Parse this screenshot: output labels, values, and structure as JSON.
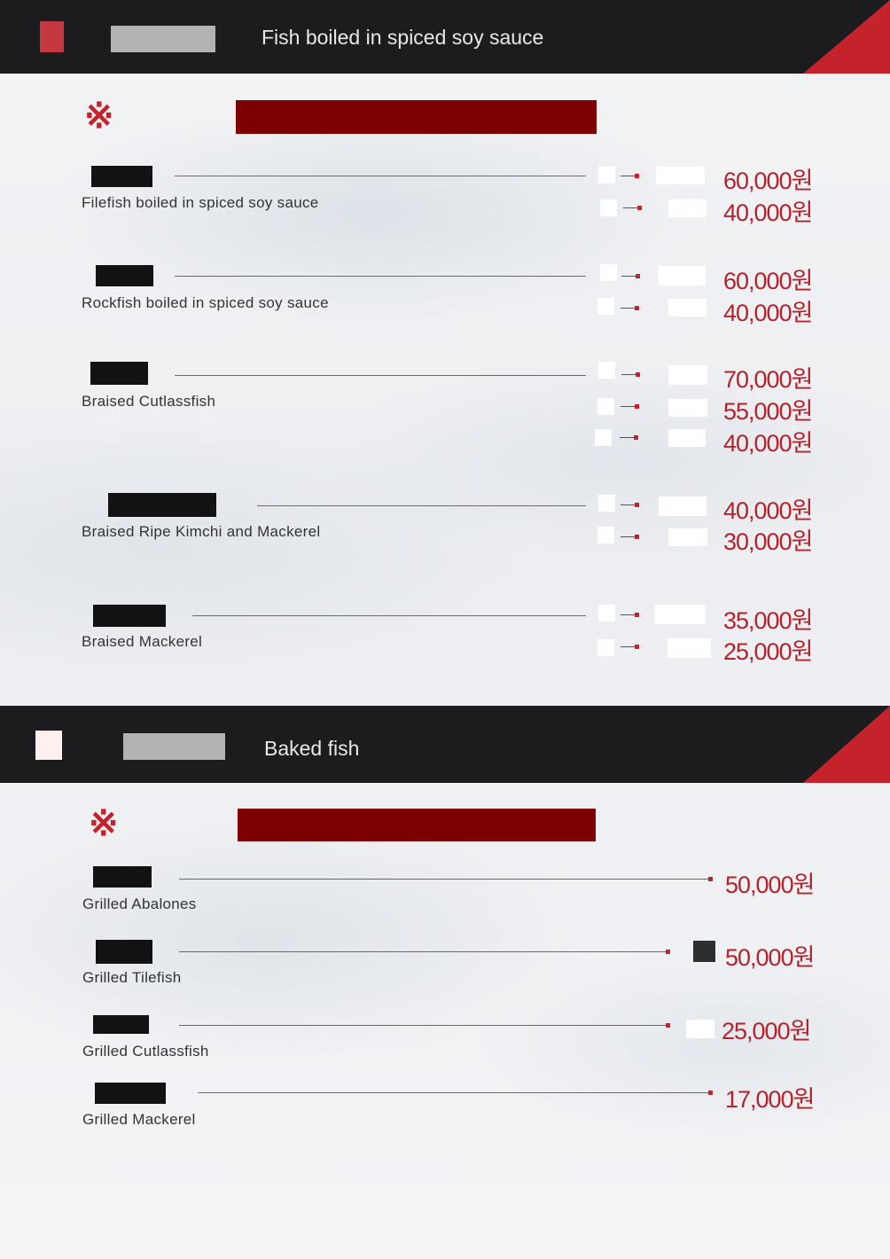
{
  "sections": [
    {
      "title": "Fish boiled in spiced soy sauce",
      "items": [
        {
          "name": "Filefish boiled in spiced soy sauce",
          "prices": [
            "60,000원",
            "40,000원"
          ]
        },
        {
          "name": "Rockfish boiled in spiced soy sauce",
          "prices": [
            "60,000원",
            "40,000원"
          ]
        },
        {
          "name": "Braised Cutlassfish",
          "prices": [
            "70,000원",
            "55,000원",
            "40,000원"
          ]
        },
        {
          "name": "Braised Ripe Kimchi and Mackerel",
          "prices": [
            "40,000원",
            "30,000원"
          ]
        },
        {
          "name": "Braised Mackerel",
          "prices": [
            "35,000원",
            "25,000원"
          ]
        }
      ]
    },
    {
      "title": "Baked fish",
      "items": [
        {
          "name": "Grilled Abalones",
          "prices": [
            "50,000원"
          ]
        },
        {
          "name": "Grilled Tilefish",
          "prices": [
            "50,000원"
          ]
        },
        {
          "name": "Grilled Cutlassfish",
          "prices": [
            "25,000원"
          ]
        },
        {
          "name": "Grilled Mackerel",
          "prices": [
            "17,000원"
          ]
        }
      ]
    }
  ],
  "icons": {
    "section_mark": "reference-mark-icon"
  },
  "colors": {
    "header_bg": "#1c1b1e",
    "accent_red": "#c4232c",
    "banner_red": "#7c0000",
    "price_red": "#b4232b"
  }
}
